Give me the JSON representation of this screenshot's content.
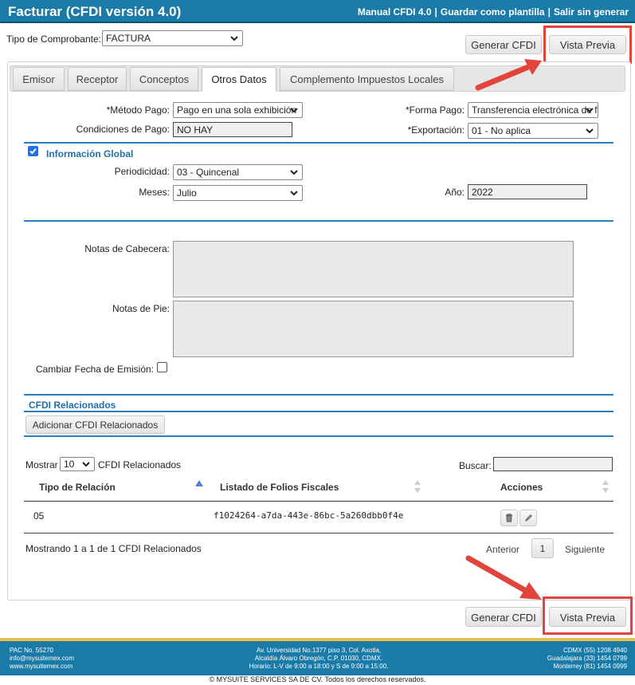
{
  "header": {
    "title": "Facturar (CFDI versión 4.0)",
    "links": [
      "Manual CFDI 4.0",
      "Guardar como plantilla",
      "Salir sin generar"
    ]
  },
  "comprobante": {
    "label": "Tipo de Comprobante:",
    "value": "FACTURA"
  },
  "actions": {
    "generar": "Generar CFDI",
    "vista_previa": "Vista Previa"
  },
  "tabs": [
    "Emisor",
    "Receptor",
    "Conceptos",
    "Otros Datos",
    "Complemento Impuestos Locales"
  ],
  "form": {
    "metodo_pago_label": "*Método Pago:",
    "metodo_pago_value": "Pago en una sola exhibición",
    "forma_pago_label": "*Forma Pago:",
    "forma_pago_value": "Transferencia electrónica de fondos",
    "condiciones_label": "Condiciones de Pago:",
    "condiciones_value": "NO HAY",
    "exportacion_label": "*Exportación:",
    "exportacion_value": "01 - No aplica"
  },
  "global": {
    "title": "Información Global",
    "periodicidad_label": "Periodicidad:",
    "periodicidad_value": "03 - Quincenal",
    "meses_label": "Meses:",
    "meses_value": "Julio",
    "anio_label": "Año:",
    "anio_value": "2022"
  },
  "notes": {
    "cabecera_label": "Notas de Cabecera:",
    "pie_label": "Notas de Pie:",
    "fecha_label": "Cambiar Fecha de Emisión:"
  },
  "relacionados": {
    "title": "CFDI Relacionados",
    "add_button": "Adicionar CFDI Relacionados",
    "mostrar_label": "Mostrar",
    "mostrar_value": "10",
    "mostrar_suffix": "CFDI Relacionados",
    "buscar_label": "Buscar:",
    "columns": [
      "Tipo de Relación",
      "Listado de Folios Fiscales",
      "Acciones"
    ],
    "rows": [
      {
        "tipo": "05",
        "folio": "f1024264-a7da-443e-86bc-5a260dbb0f4e"
      }
    ],
    "info": "Mostrando 1 a 1 de 1 CFDI Relacionados",
    "prev": "Anterior",
    "page": "1",
    "next": "Siguiente"
  },
  "footer": {
    "left": [
      "PAC No. 55270",
      "info@mysuitemex.com",
      "www.mysuitemex.com"
    ],
    "center": [
      "Av. Universidad No.1377 piso 3, Col. Axotla,",
      "Alcaldía Álvaro Obregón, C.P. 01030, CDMX.",
      "Horario: L-V de 9:00 a 18:00 y S de 9:00 a 15:00."
    ],
    "right": [
      "CDMX (55) 1208 4940",
      "Guadalajara (33) 1454 0799",
      "Monterrey (81) 1454 0999"
    ],
    "copyright": "© MYSUITE SERVICES SA DE CV. Todos los derechos reservados."
  },
  "colors": {
    "header": "#1a7aa8",
    "accent": "#2a7db5",
    "highlight": "#e0443a",
    "footer_stripe": "#e8c14a"
  },
  "icons": [
    "chevron-down-icon",
    "sort-up-icon",
    "sort-icon",
    "trash-icon",
    "pencil-icon",
    "arrow-icon"
  ]
}
